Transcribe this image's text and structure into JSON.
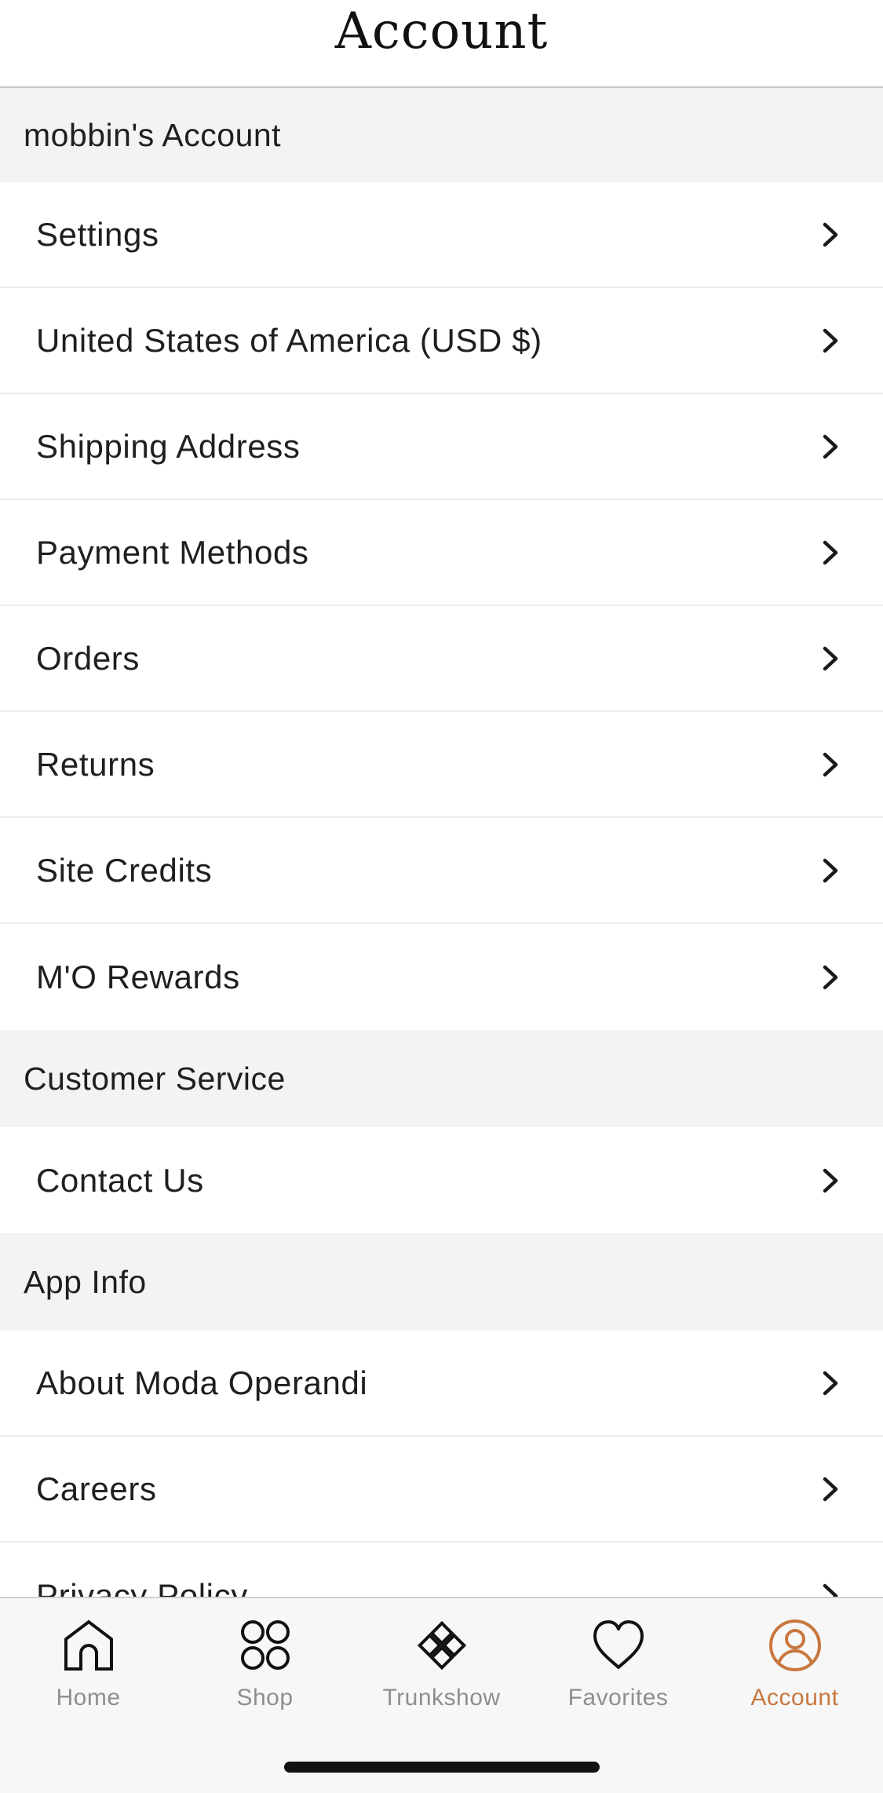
{
  "header": {
    "title": "Account"
  },
  "sections": [
    {
      "title": "mobbin's Account",
      "items": [
        {
          "label": "Settings"
        },
        {
          "label": "United States of America (USD $)"
        },
        {
          "label": "Shipping Address"
        },
        {
          "label": "Payment Methods"
        },
        {
          "label": "Orders"
        },
        {
          "label": "Returns"
        },
        {
          "label": "Site Credits"
        },
        {
          "label": "M'O Rewards"
        }
      ]
    },
    {
      "title": "Customer Service",
      "items": [
        {
          "label": "Contact Us"
        }
      ]
    },
    {
      "title": "App Info",
      "items": [
        {
          "label": "About Moda Operandi"
        },
        {
          "label": "Careers"
        },
        {
          "label": "Privacy Policy"
        }
      ]
    }
  ],
  "tabbar": {
    "tabs": [
      {
        "label": "Home",
        "icon": "home-icon"
      },
      {
        "label": "Shop",
        "icon": "grid-circles-icon"
      },
      {
        "label": "Trunkshow",
        "icon": "diamond-grid-icon"
      },
      {
        "label": "Favorites",
        "icon": "heart-icon"
      },
      {
        "label": "Account",
        "icon": "user-circle-icon"
      }
    ],
    "active_tab": "Account",
    "colors": {
      "active": "#c8773f",
      "inactive": "#8e8e90"
    }
  }
}
